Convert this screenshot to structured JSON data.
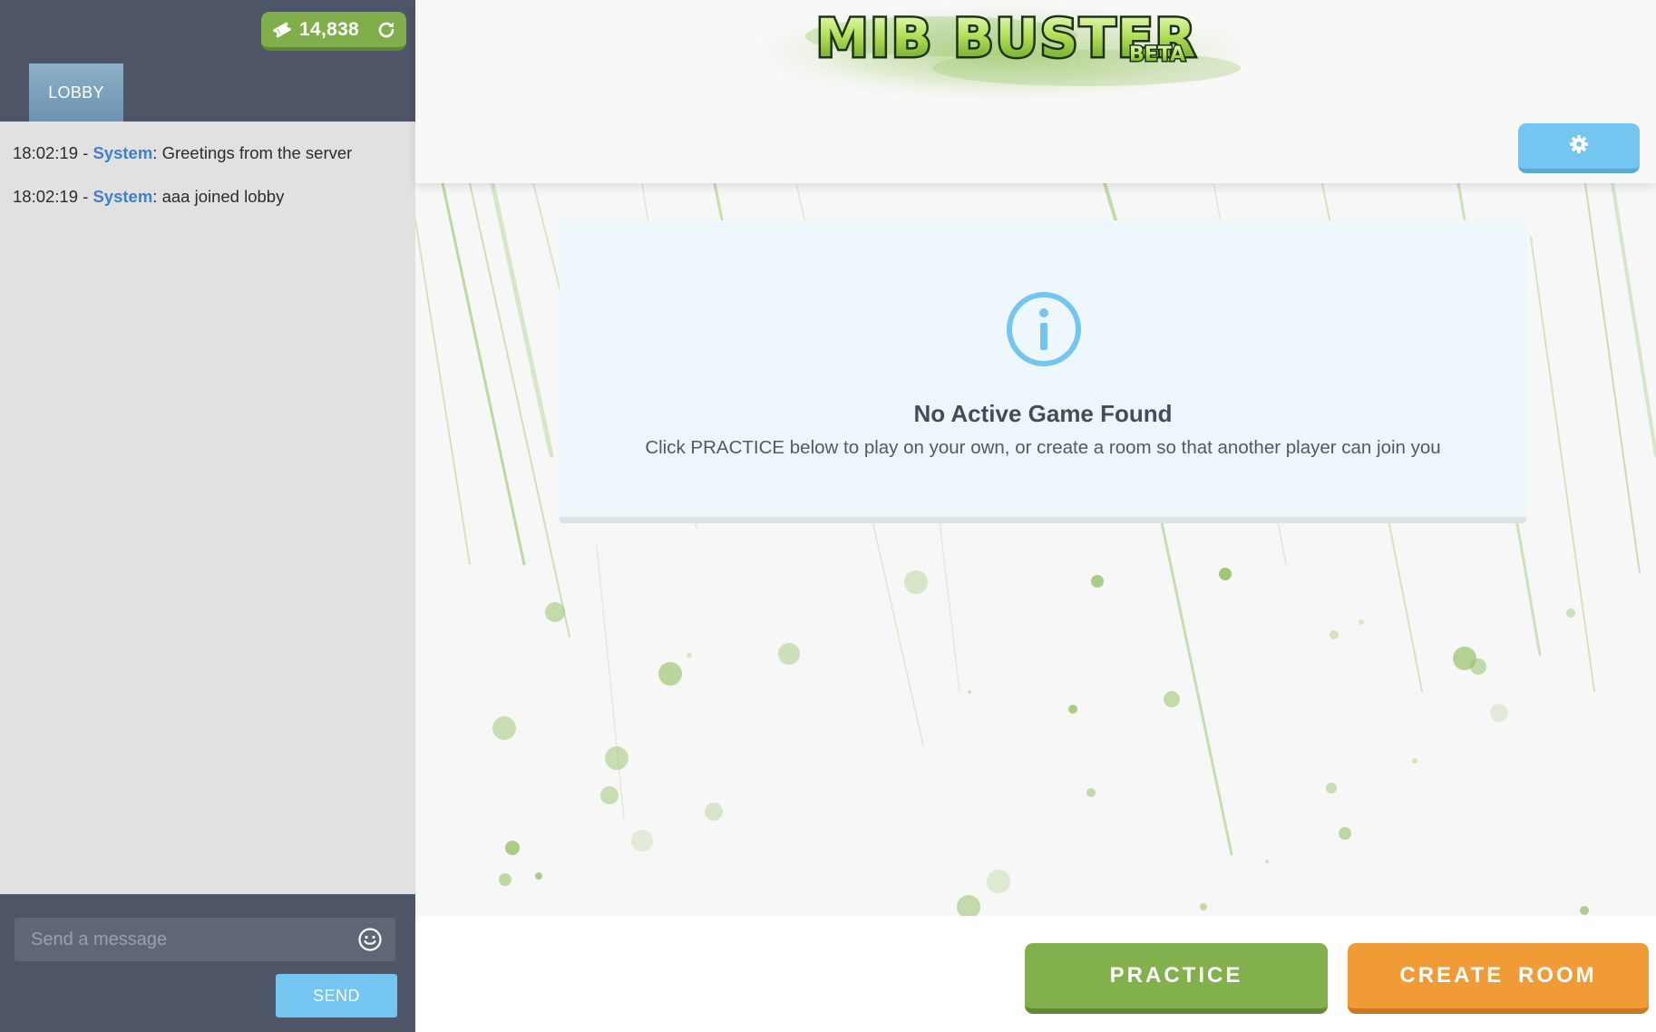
{
  "sidebar": {
    "coins": "14,838",
    "tab_label": "LOBBY",
    "chat": [
      {
        "time": "18:02:19",
        "sep": " - ",
        "sender": "System",
        "message": ": Greetings from the server"
      },
      {
        "time": "18:02:19",
        "sep": " - ",
        "sender": "System",
        "message": ": aaa joined lobby"
      }
    ],
    "input_placeholder": "Send a message",
    "send_label": "SEND"
  },
  "header": {
    "logo_text": "MIB BUSTER",
    "logo_badge": "BETA"
  },
  "notice": {
    "title": "No Active Game Found",
    "text": "Click PRACTICE below to play on your own, or create a room so that another player can join you"
  },
  "footer": {
    "practice_label": "PRACTICE",
    "create_room_label": "CREATE ROOM"
  },
  "colors": {
    "sidebar_dark": "#4e5566",
    "accent_green": "#82b04c",
    "accent_orange": "#f19b36",
    "accent_blue": "#74c5ef",
    "sender_blue": "#3d7fd1"
  },
  "icons": [
    "ticket-icon",
    "refresh-icon",
    "emoji-icon",
    "gear-icon",
    "info-icon"
  ]
}
